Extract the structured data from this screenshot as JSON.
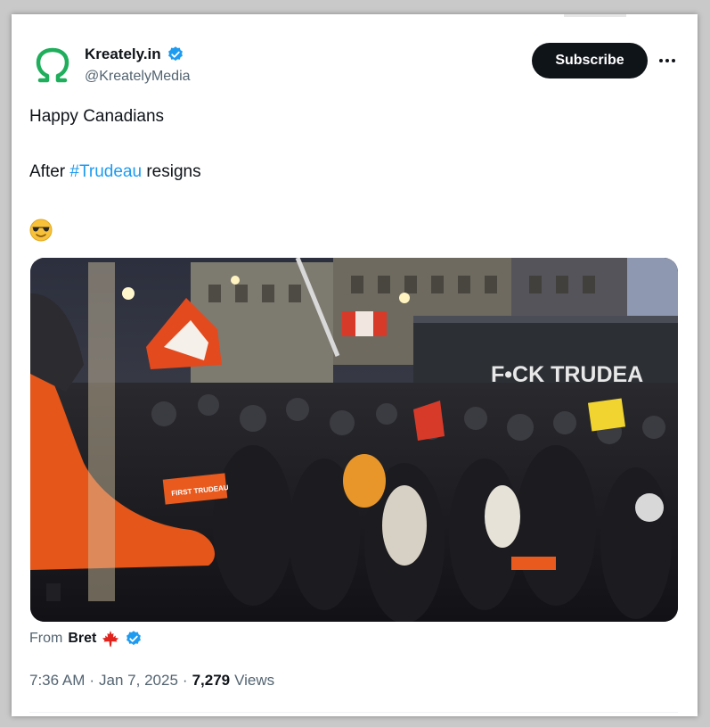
{
  "author": {
    "display_name": "Kreately.in",
    "handle": "@KreatelyMedia",
    "avatar_icon": "omega-logo-icon",
    "verified_icon": "verified-badge-icon",
    "verified_color": "#1d9bf0",
    "logo_color": "#1fae5b"
  },
  "actions": {
    "subscribe_label": "Subscribe",
    "more_icon": "more-options-icon"
  },
  "post": {
    "line1": "Happy Canadians",
    "line2_prefix": "After ",
    "hashtag": "#Trudeau",
    "line2_suffix": " resigns",
    "emoji": "smiling-face-with-sunglasses"
  },
  "media": {
    "bus_text": "F•CK TRUDEA",
    "sign_text": "FIRST TRUDEAU"
  },
  "attribution": {
    "from_label": "From",
    "from_name": "Bret",
    "flag_icon": "maple-leaf-icon",
    "flag_color": "#e0231c"
  },
  "meta": {
    "time": "7:36 AM",
    "separator": "·",
    "date": "Jan 7, 2025",
    "views_count": "7,279",
    "views_label": "Views"
  },
  "colors": {
    "accent": "#1d9bf0",
    "text": "#0f1419",
    "secondary": "#536471"
  }
}
